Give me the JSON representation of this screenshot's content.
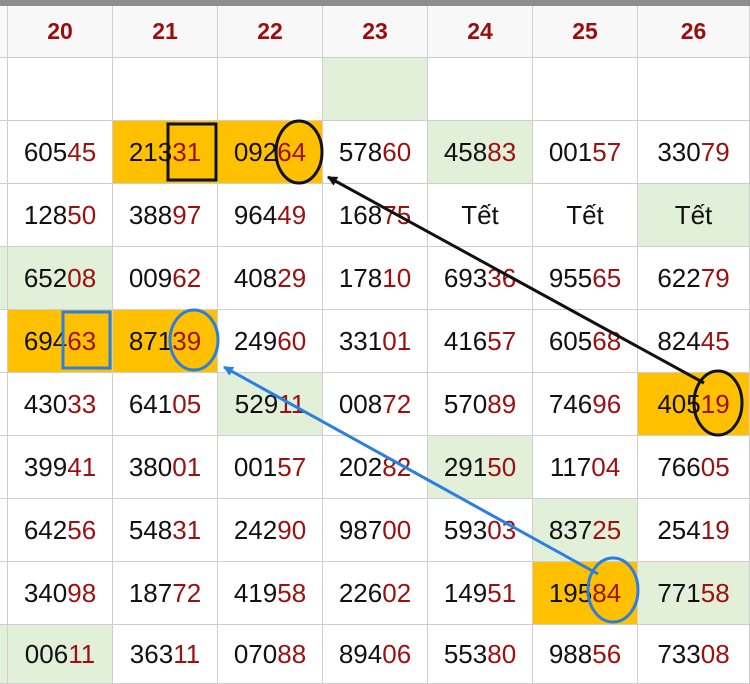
{
  "colors": {
    "header_text": "#9b0d0d",
    "tail_text": "#9b1111",
    "highlight": "#ffc000",
    "light_green": "#e2f0d9",
    "black_arrow": "#111111",
    "blue_arrow": "#2a7fe0"
  },
  "headers": [
    "20",
    "21",
    "22",
    "23",
    "24",
    "25",
    "26"
  ],
  "rows": [
    [
      {
        "a": "",
        "b": "",
        "bg": ""
      },
      {
        "a": "",
        "b": "",
        "bg": ""
      },
      {
        "a": "",
        "b": "",
        "bg": ""
      },
      {
        "a": "",
        "b": "",
        "bg": "green"
      },
      {
        "a": "",
        "b": "",
        "bg": ""
      },
      {
        "a": "",
        "b": "",
        "bg": ""
      },
      {
        "a": "",
        "b": "",
        "bg": ""
      }
    ],
    [
      {
        "a": "605",
        "b": "45",
        "bg": ""
      },
      {
        "a": "213",
        "b": "31",
        "bg": "orange"
      },
      {
        "a": "092",
        "b": "64",
        "bg": "orange"
      },
      {
        "a": "578",
        "b": "60",
        "bg": ""
      },
      {
        "a": "458",
        "b": "83",
        "bg": "green"
      },
      {
        "a": "001",
        "b": "57",
        "bg": ""
      },
      {
        "a": "330",
        "b": "79",
        "bg": ""
      }
    ],
    [
      {
        "a": "128",
        "b": "50",
        "bg": ""
      },
      {
        "a": "388",
        "b": "97",
        "bg": ""
      },
      {
        "a": "964",
        "b": "49",
        "bg": ""
      },
      {
        "a": "168",
        "b": "75",
        "bg": ""
      },
      {
        "text": "Tết",
        "bg": ""
      },
      {
        "text": "Tết",
        "bg": ""
      },
      {
        "text": "Tết",
        "bg": "green"
      }
    ],
    [
      {
        "a": "652",
        "b": "08",
        "bg": "green"
      },
      {
        "a": "009",
        "b": "62",
        "bg": ""
      },
      {
        "a": "408",
        "b": "29",
        "bg": ""
      },
      {
        "a": "178",
        "b": "10",
        "bg": ""
      },
      {
        "a": "693",
        "b": "36",
        "bg": ""
      },
      {
        "a": "955",
        "b": "65",
        "bg": ""
      },
      {
        "a": "622",
        "b": "79",
        "bg": ""
      }
    ],
    [
      {
        "a": "694",
        "b": "63",
        "bg": "orange"
      },
      {
        "a": "871",
        "b": "39",
        "bg": "orange"
      },
      {
        "a": "249",
        "b": "60",
        "bg": ""
      },
      {
        "a": "331",
        "b": "01",
        "bg": ""
      },
      {
        "a": "416",
        "b": "57",
        "bg": ""
      },
      {
        "a": "605",
        "b": "68",
        "bg": ""
      },
      {
        "a": "824",
        "b": "45",
        "bg": ""
      }
    ],
    [
      {
        "a": "430",
        "b": "33",
        "bg": ""
      },
      {
        "a": "641",
        "b": "05",
        "bg": ""
      },
      {
        "a": "529",
        "b": "11",
        "bg": "green"
      },
      {
        "a": "008",
        "b": "72",
        "bg": ""
      },
      {
        "a": "570",
        "b": "89",
        "bg": ""
      },
      {
        "a": "746",
        "b": "96",
        "bg": ""
      },
      {
        "a": "405",
        "b": "19",
        "bg": "orange"
      }
    ],
    [
      {
        "a": "399",
        "b": "41",
        "bg": ""
      },
      {
        "a": "380",
        "b": "01",
        "bg": ""
      },
      {
        "a": "001",
        "b": "57",
        "bg": ""
      },
      {
        "a": "202",
        "b": "82",
        "bg": ""
      },
      {
        "a": "291",
        "b": "50",
        "bg": "green"
      },
      {
        "a": "117",
        "b": "04",
        "bg": ""
      },
      {
        "a": "766",
        "b": "05",
        "bg": ""
      }
    ],
    [
      {
        "a": "642",
        "b": "56",
        "bg": ""
      },
      {
        "a": "548",
        "b": "31",
        "bg": ""
      },
      {
        "a": "242",
        "b": "90",
        "bg": ""
      },
      {
        "a": "987",
        "b": "00",
        "bg": ""
      },
      {
        "a": "593",
        "b": "03",
        "bg": ""
      },
      {
        "a": "837",
        "b": "25",
        "bg": "green"
      },
      {
        "a": "254",
        "b": "19",
        "bg": ""
      }
    ],
    [
      {
        "a": "340",
        "b": "98",
        "bg": ""
      },
      {
        "a": "187",
        "b": "72",
        "bg": ""
      },
      {
        "a": "419",
        "b": "58",
        "bg": ""
      },
      {
        "a": "226",
        "b": "02",
        "bg": ""
      },
      {
        "a": "149",
        "b": "51",
        "bg": ""
      },
      {
        "a": "195",
        "b": "84",
        "bg": "orange"
      },
      {
        "a": "771",
        "b": "58",
        "bg": "green"
      }
    ],
    [
      {
        "a": "006",
        "b": "11",
        "bg": "green"
      },
      {
        "a": "363",
        "b": "11",
        "bg": ""
      },
      {
        "a": "070",
        "b": "88",
        "bg": ""
      },
      {
        "a": "894",
        "b": "06",
        "bg": ""
      },
      {
        "a": "553",
        "b": "80",
        "bg": ""
      },
      {
        "a": "988",
        "b": "56",
        "bg": ""
      },
      {
        "a": "733",
        "b": "08",
        "bg": ""
      }
    ]
  ]
}
